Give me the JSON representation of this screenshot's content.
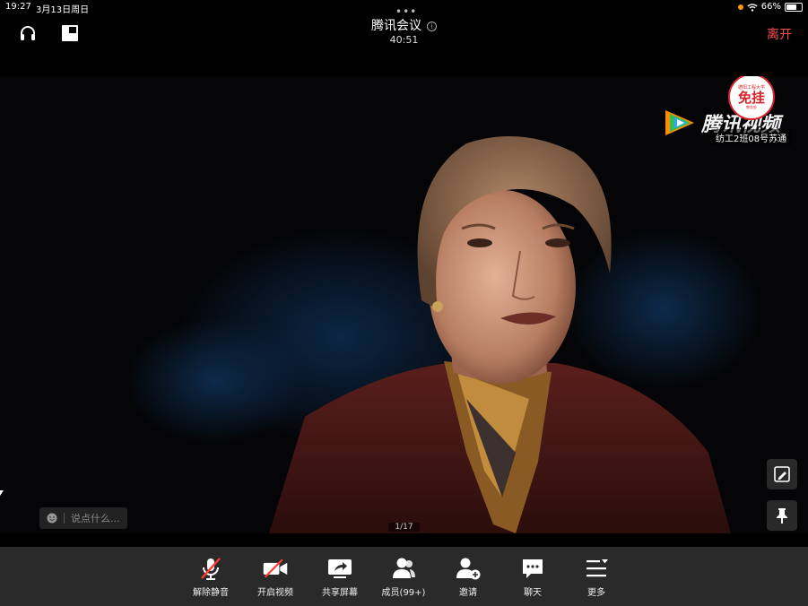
{
  "status_bar": {
    "time": "19:27",
    "date": "3月13日周日",
    "battery_text": "66%",
    "battery_level": 0.66,
    "accent": "#ff9500"
  },
  "header": {
    "title": "腾讯会议",
    "timer": "40:51",
    "leave_label": "离开",
    "leave_color": "#ff4d4d",
    "dots": "•••"
  },
  "video": {
    "watermark_text": "腾讯视频",
    "seal": {
      "top": "德阳工程大学",
      "main": "免挂",
      "bottom": "教务处"
    },
    "name_tag": "纺工2班08号苏通",
    "chat_placeholder": "说点什么...",
    "page_indicator": "1/17"
  },
  "toolbar": {
    "items": [
      {
        "label": "解除静音",
        "icon": "microphone-muted-icon"
      },
      {
        "label": "开启视频",
        "icon": "video-off-icon"
      },
      {
        "label": "共享屏幕",
        "icon": "share-screen-icon"
      },
      {
        "label": "成员(99+)",
        "icon": "members-icon"
      },
      {
        "label": "邀请",
        "icon": "invite-user-icon"
      },
      {
        "label": "聊天",
        "icon": "chat-icon"
      },
      {
        "label": "更多",
        "icon": "more-menu-icon"
      }
    ]
  }
}
